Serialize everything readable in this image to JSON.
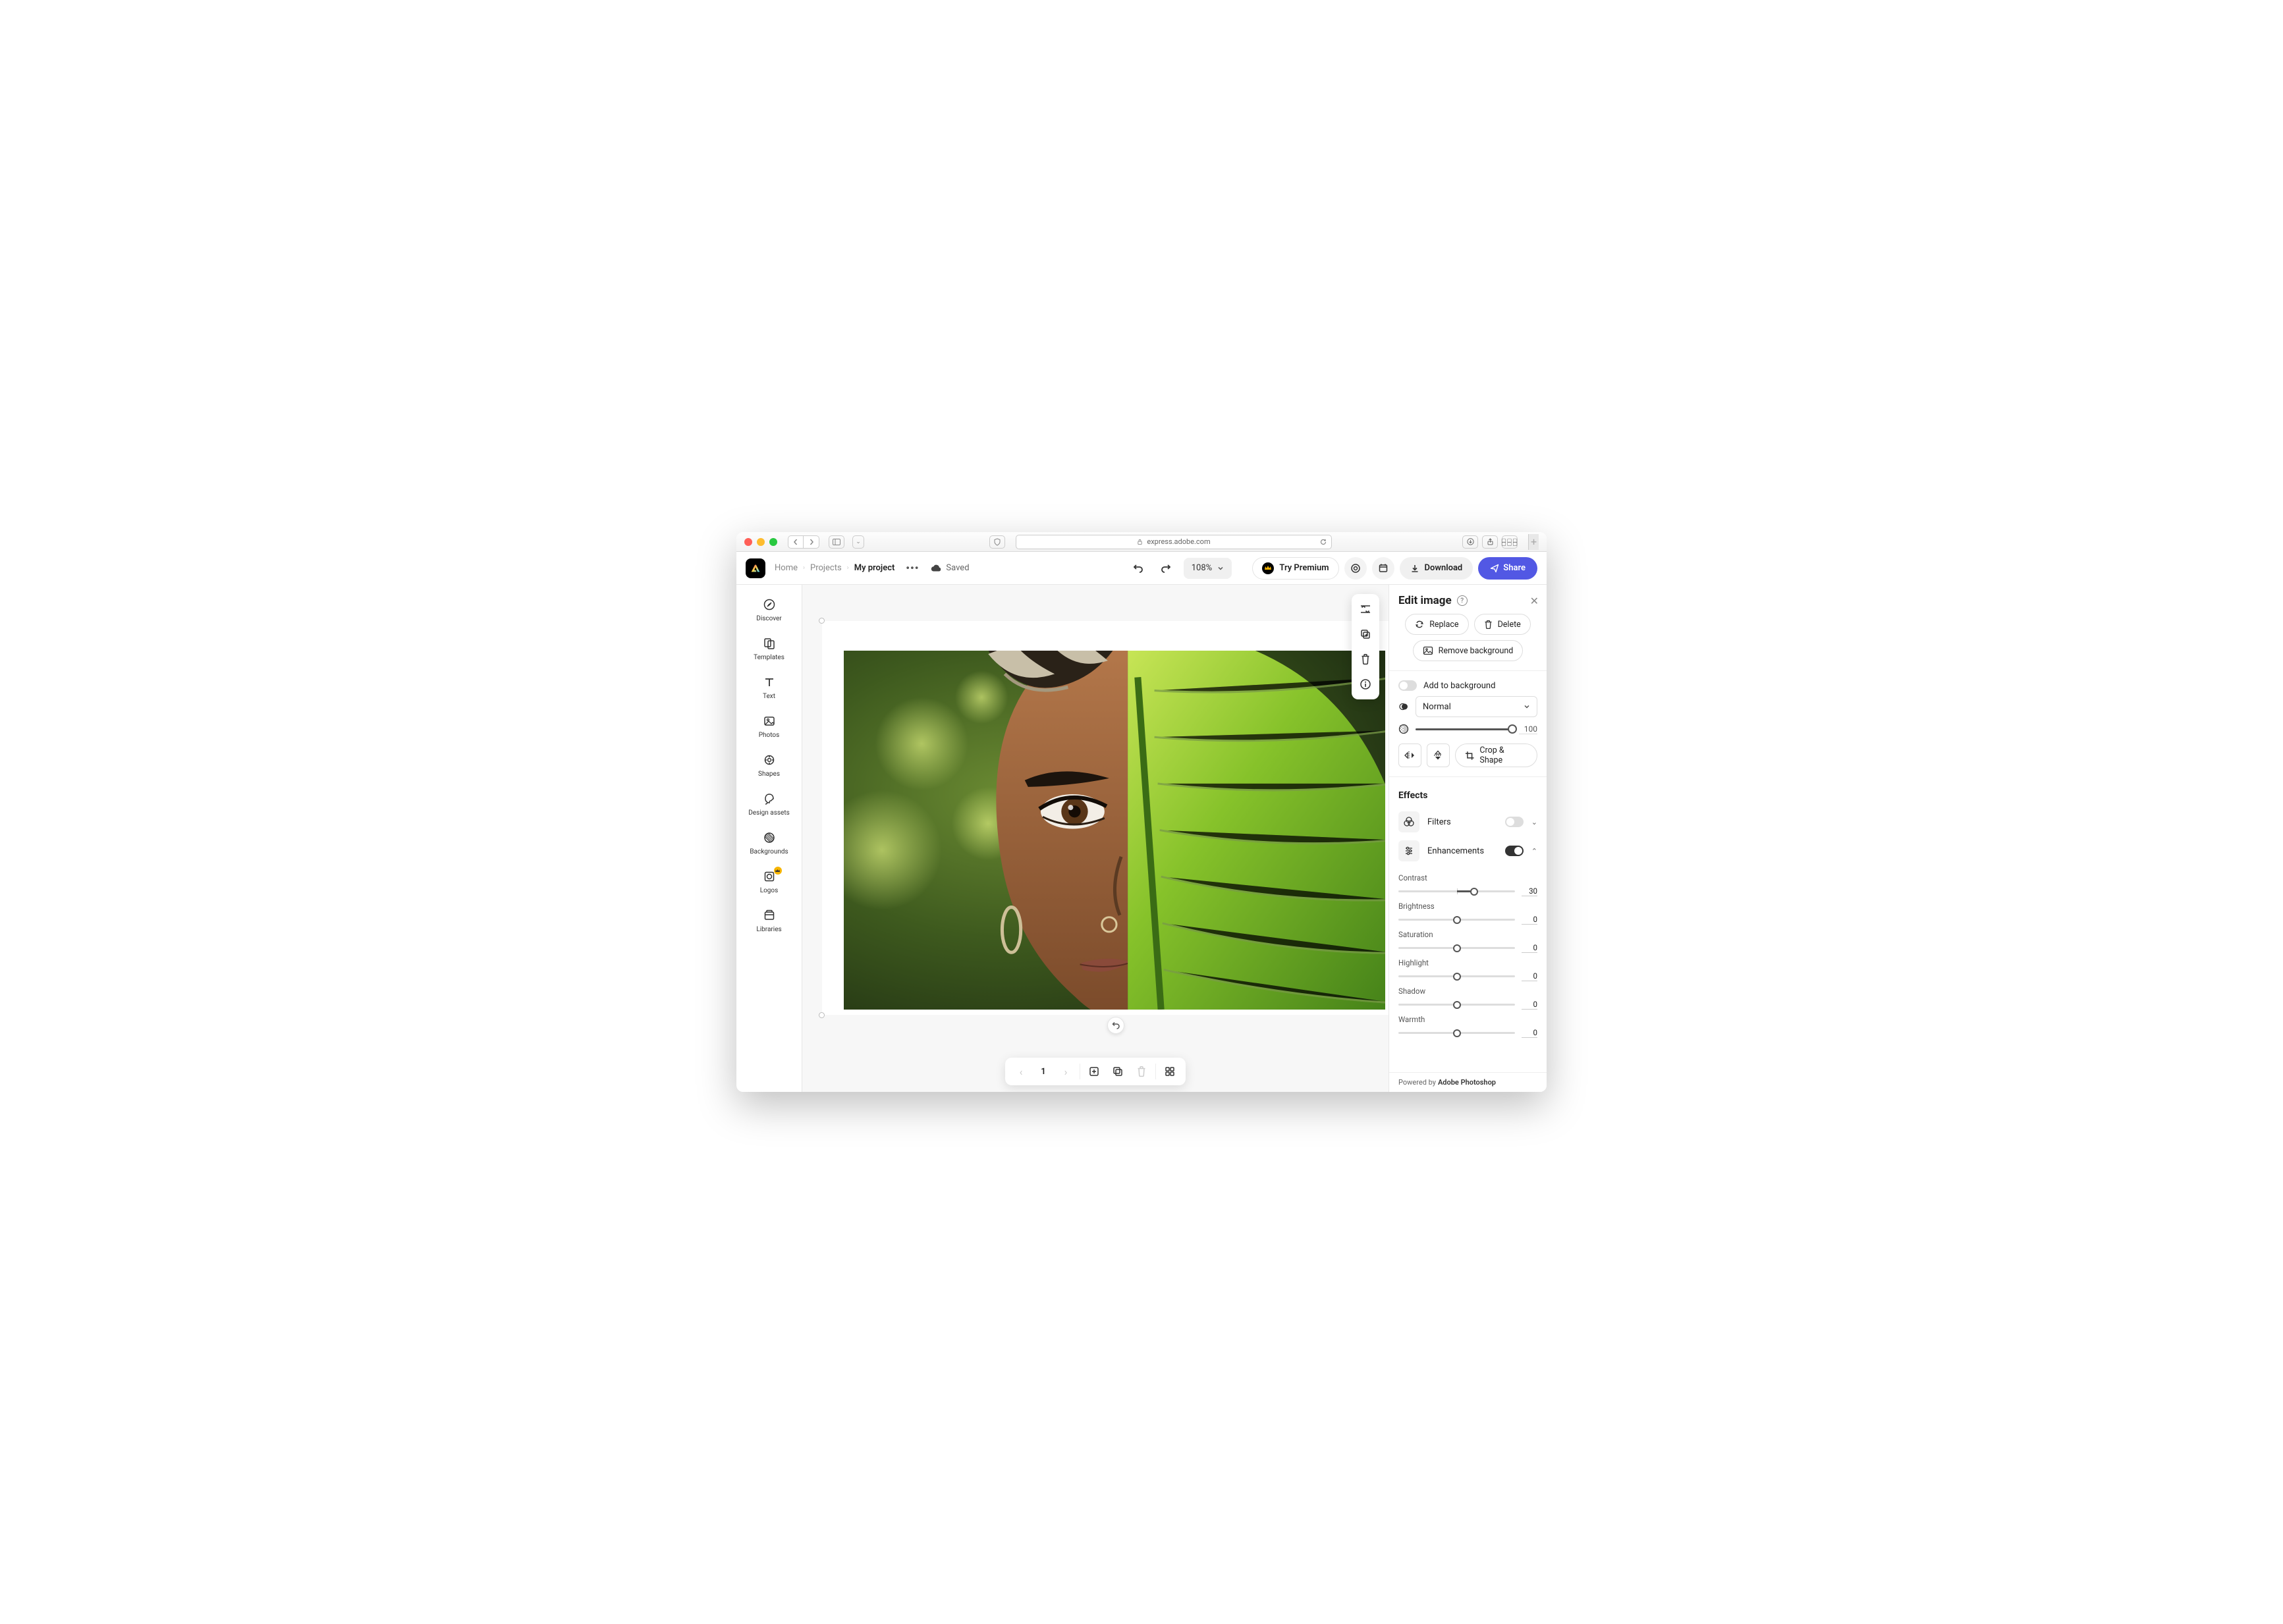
{
  "browser": {
    "url": "express.adobe.com"
  },
  "breadcrumb": {
    "home": "Home",
    "projects": "Projects",
    "current": "My project"
  },
  "saved_label": "Saved",
  "zoom": "108%",
  "topbar": {
    "premium": "Try Premium",
    "download": "Download",
    "share": "Share"
  },
  "sidebar": {
    "items": [
      {
        "label": "Discover"
      },
      {
        "label": "Templates"
      },
      {
        "label": "Text"
      },
      {
        "label": "Photos"
      },
      {
        "label": "Shapes"
      },
      {
        "label": "Design assets"
      },
      {
        "label": "Backgrounds"
      },
      {
        "label": "Logos"
      },
      {
        "label": "Libraries"
      }
    ]
  },
  "page_bar": {
    "page": "1"
  },
  "panel": {
    "title": "Edit image",
    "replace": "Replace",
    "delete": "Delete",
    "remove_bg": "Remove background",
    "add_to_bg": "Add to background",
    "blend_mode": "Normal",
    "opacity": "100",
    "crop_shape": "Crop & Shape",
    "effects_title": "Effects",
    "filters": "Filters",
    "enhancements": "Enhancements",
    "enh": {
      "contrast": {
        "label": "Contrast",
        "value": "30"
      },
      "brightness": {
        "label": "Brightness",
        "value": "0"
      },
      "saturation": {
        "label": "Saturation",
        "value": "0"
      },
      "highlight": {
        "label": "Highlight",
        "value": "0"
      },
      "shadow": {
        "label": "Shadow",
        "value": "0"
      },
      "warmth": {
        "label": "Warmth",
        "value": "0"
      }
    },
    "footer_prefix": "Powered by",
    "footer_brand": "Adobe Photoshop"
  }
}
